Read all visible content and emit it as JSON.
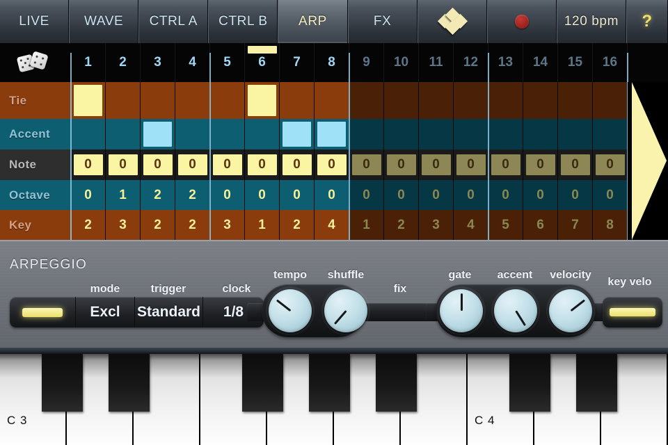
{
  "topbar": {
    "tabs": [
      {
        "label": "LIVE",
        "selected": false
      },
      {
        "label": "WAVE",
        "selected": false
      },
      {
        "label": "CTRL A",
        "selected": false
      },
      {
        "label": "CTRL B",
        "selected": false
      },
      {
        "label": "ARP",
        "selected": true
      },
      {
        "label": "FX",
        "selected": false
      }
    ],
    "pattern_icon": "diamond-grid-icon",
    "record_icon": "record-dot-icon",
    "bpm": "120 bpm",
    "help": "?"
  },
  "sequencer": {
    "randomize_icon": "dice-icon",
    "steps": [
      "1",
      "2",
      "3",
      "4",
      "5",
      "6",
      "7",
      "8",
      "9",
      "10",
      "11",
      "12",
      "13",
      "14",
      "15",
      "16"
    ],
    "active_steps": 8,
    "playhead_step": 6,
    "arrow_icon": "play-arrow-icon",
    "rows": [
      {
        "label": "Tie",
        "type": "toggle",
        "values": [
          true,
          false,
          false,
          false,
          false,
          true,
          false,
          false,
          false,
          false,
          false,
          false,
          false,
          false,
          false,
          false
        ]
      },
      {
        "label": "Accent",
        "type": "toggle",
        "values": [
          false,
          false,
          true,
          false,
          false,
          false,
          true,
          true,
          false,
          false,
          false,
          false,
          false,
          false,
          false,
          false
        ]
      },
      {
        "label": "Note",
        "type": "boxed",
        "values": [
          "0",
          "0",
          "0",
          "0",
          "0",
          "0",
          "0",
          "0",
          "0",
          "0",
          "0",
          "0",
          "0",
          "0",
          "0",
          "0"
        ]
      },
      {
        "label": "Octave",
        "type": "number",
        "values": [
          "0",
          "1",
          "2",
          "2",
          "0",
          "0",
          "0",
          "0",
          "0",
          "0",
          "0",
          "0",
          "0",
          "0",
          "0",
          "0"
        ]
      },
      {
        "label": "Key",
        "type": "number",
        "values": [
          "2",
          "3",
          "2",
          "2",
          "3",
          "1",
          "2",
          "4",
          "1",
          "2",
          "3",
          "4",
          "5",
          "6",
          "7",
          "8"
        ]
      }
    ]
  },
  "arpeggio": {
    "title": "ARPEGGIO",
    "on_led": "power-led",
    "mode": {
      "label": "mode",
      "value": "Excl"
    },
    "trigger": {
      "label": "trigger",
      "value": "Standard"
    },
    "clock": {
      "label": "clock",
      "value": "1/8"
    },
    "knobs": [
      {
        "label": "tempo",
        "angle": -52
      },
      {
        "label": "shuffle",
        "angle": -139
      },
      {
        "label": "gate",
        "angle": 0
      },
      {
        "label": "accent",
        "angle": 148
      },
      {
        "label": "velocity",
        "angle": 52
      }
    ],
    "fix": {
      "label": "fix"
    },
    "key_velo": {
      "label": "key velo",
      "led": "key-velo-led"
    }
  },
  "keyboard": {
    "labels": [
      {
        "text": "C 3",
        "key_index": 0
      },
      {
        "text": "C 4",
        "key_index": 7
      }
    ],
    "white_key_count": 10,
    "black_key_positions": [
      0,
      1,
      3,
      4,
      5,
      7,
      8
    ]
  },
  "colors": {
    "accent_yellow": "#faf5a2",
    "accent_blue": "#9fe2f7",
    "brown": "#8a3c0d",
    "teal": "#0e5e72",
    "tab_text": "#cfe6f5"
  }
}
